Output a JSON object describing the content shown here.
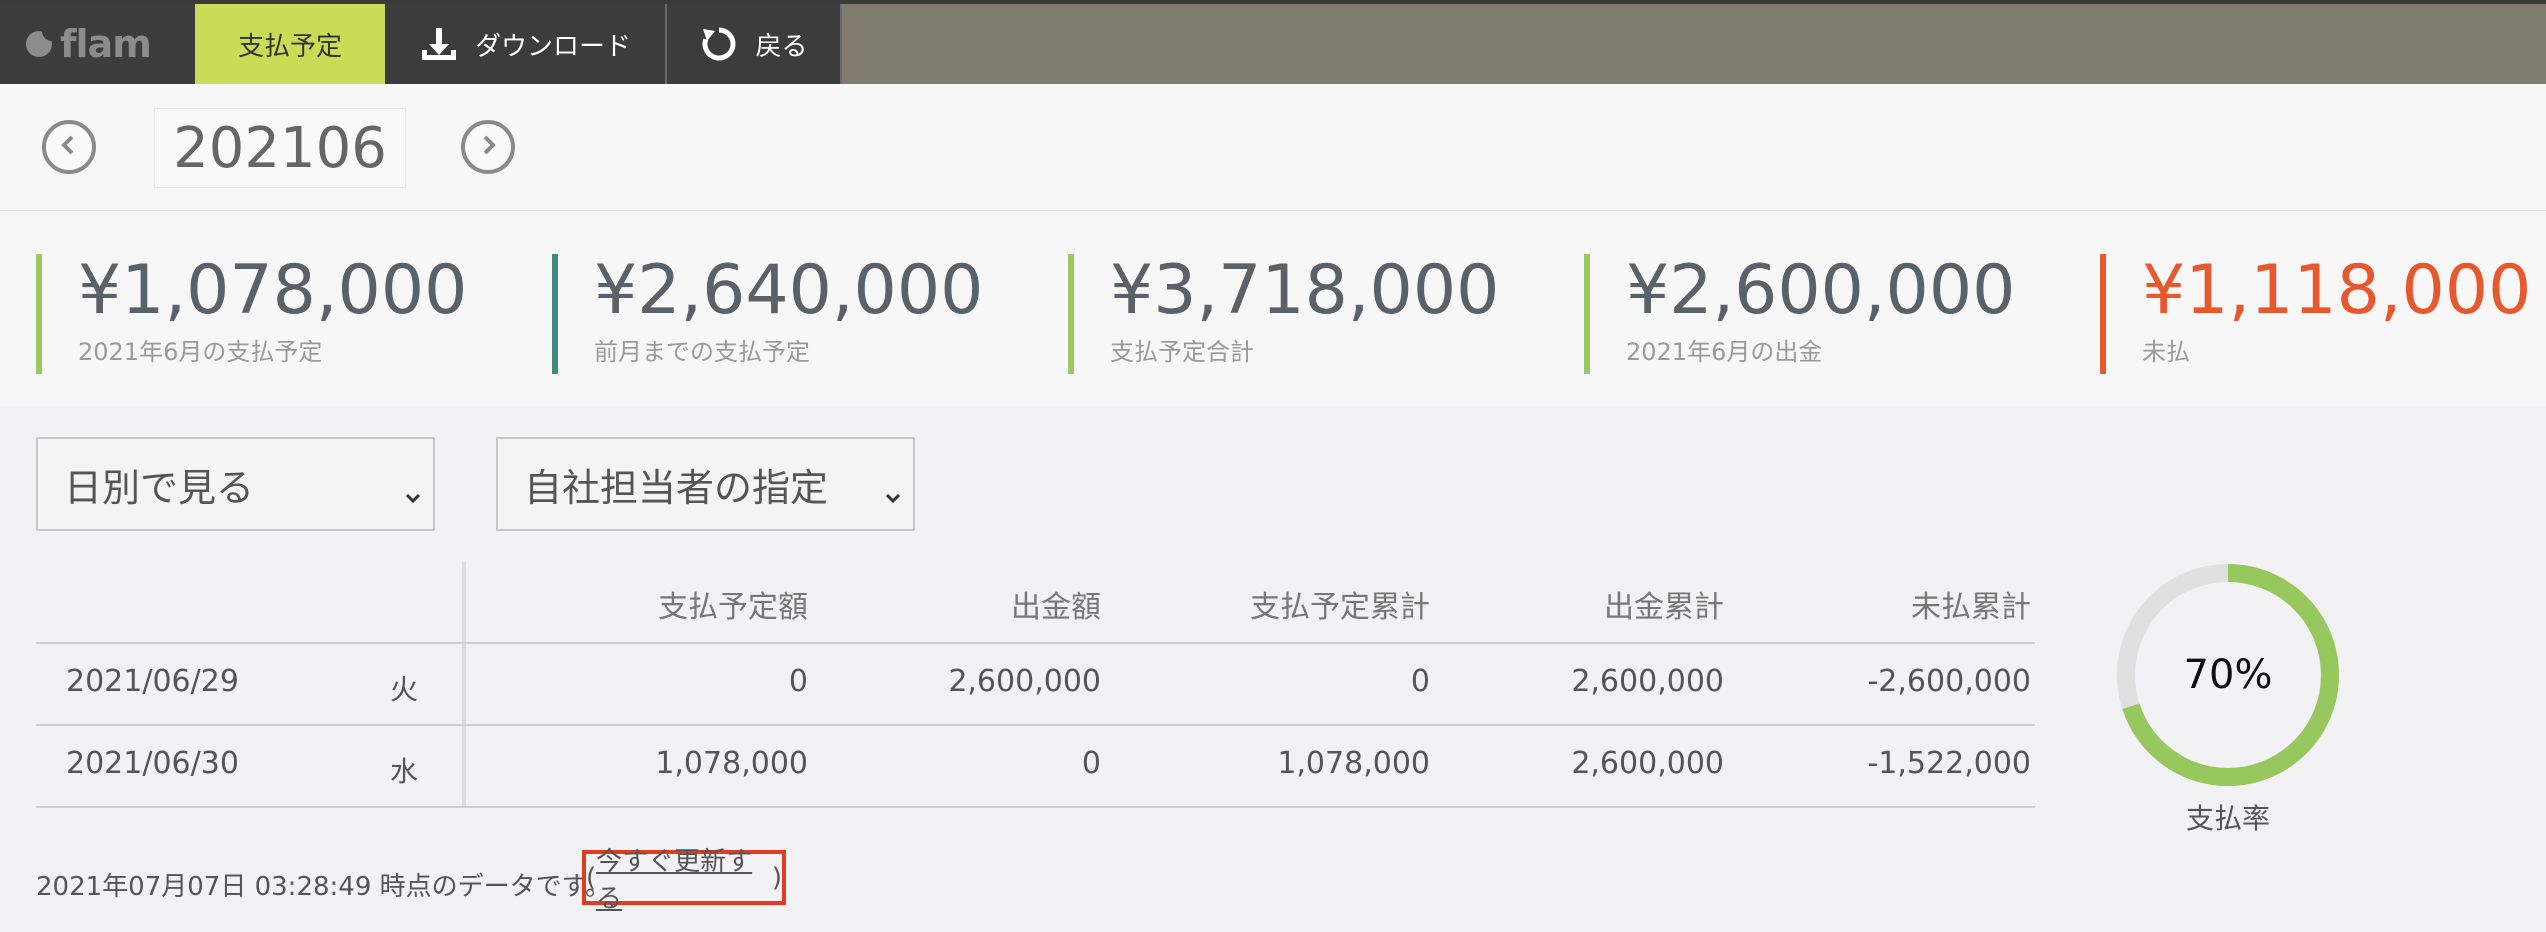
{
  "app": {
    "logo_text": "flam"
  },
  "nav": {
    "tabs": [
      {
        "label": "支払予定",
        "icon": "none",
        "active": true
      },
      {
        "label": "ダウンロード",
        "icon": "download-icon",
        "active": false
      },
      {
        "label": "戻る",
        "icon": "refresh-icon",
        "active": false
      }
    ],
    "active_color": "#c9dc55"
  },
  "period": {
    "value": "202106",
    "prev_icon": "chevron-left-icon",
    "next_icon": "chevron-right-icon"
  },
  "stats": [
    {
      "value": "¥1,078,000",
      "label": "2021年6月の支払予定",
      "bar_color": "#9bc95f"
    },
    {
      "value": "¥2,640,000",
      "label": "前月までの支払予定",
      "bar_color": "#3d8a83"
    },
    {
      "value": "¥3,718,000",
      "label": "支払予定合計",
      "bar_color": "#9bc95f"
    },
    {
      "value": "¥2,600,000",
      "label": "2021年6月の出金",
      "bar_color": "#9bc95f"
    },
    {
      "value": "¥1,118,000",
      "label": "未払",
      "bar_color": "#e8582d"
    }
  ],
  "filters": {
    "view_select": "日別で見る",
    "person_select": "自社担当者の指定"
  },
  "table": {
    "columns": [
      "",
      "",
      "支払予定額",
      "出金額",
      "支払予定累計",
      "出金累計",
      "未払累計"
    ],
    "rows": [
      [
        "2021/06/29",
        "火",
        "0",
        "2,600,000",
        "0",
        "2,600,000",
        "-2,600,000"
      ],
      [
        "2021/06/30",
        "水",
        "1,078,000",
        "0",
        "1,078,000",
        "2,600,000",
        "-1,522,000"
      ]
    ]
  },
  "gauge": {
    "percent_text": "70%",
    "label": "支払率",
    "fraction": 0.7,
    "color": "#97c85e",
    "track_color": "#e0e0e0"
  },
  "footer": {
    "timestamp_text": "2021年07月07日 03:28:49 時点のデータです。",
    "update_link": "今すぐ更新する",
    "paren_open": "(",
    "paren_close": ")"
  }
}
